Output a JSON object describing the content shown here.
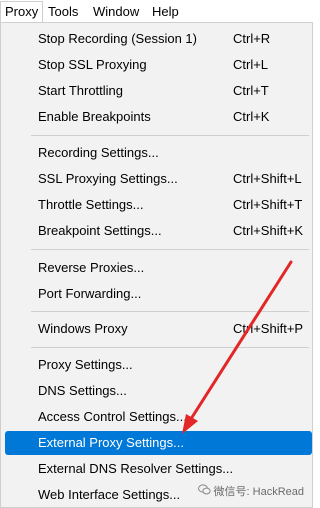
{
  "menubar": {
    "items": [
      {
        "label": "Proxy"
      },
      {
        "label": "Tools"
      },
      {
        "label": "Window"
      },
      {
        "label": "Help"
      }
    ]
  },
  "menu": {
    "items": [
      {
        "label": "Stop Recording (Session 1)",
        "shortcut": "Ctrl+R"
      },
      {
        "label": "Stop SSL Proxying",
        "shortcut": "Ctrl+L"
      },
      {
        "label": "Start Throttling",
        "shortcut": "Ctrl+T"
      },
      {
        "label": "Enable Breakpoints",
        "shortcut": "Ctrl+K"
      },
      {
        "label": "Recording Settings...",
        "shortcut": ""
      },
      {
        "label": "SSL Proxying Settings...",
        "shortcut": "Ctrl+Shift+L"
      },
      {
        "label": "Throttle Settings...",
        "shortcut": "Ctrl+Shift+T"
      },
      {
        "label": "Breakpoint Settings...",
        "shortcut": "Ctrl+Shift+K"
      },
      {
        "label": "Reverse Proxies...",
        "shortcut": ""
      },
      {
        "label": "Port Forwarding...",
        "shortcut": ""
      },
      {
        "label": "Windows Proxy",
        "shortcut": "Ctrl+Shift+P"
      },
      {
        "label": "Proxy Settings...",
        "shortcut": ""
      },
      {
        "label": "DNS Settings...",
        "shortcut": ""
      },
      {
        "label": "Access Control Settings...",
        "shortcut": ""
      },
      {
        "label": "External Proxy Settings...",
        "shortcut": ""
      },
      {
        "label": "External DNS Resolver Settings...",
        "shortcut": ""
      },
      {
        "label": "Web Interface Settings...",
        "shortcut": ""
      }
    ],
    "selected_label": "External Proxy Settings..."
  },
  "watermark": {
    "text": "微信号: HackRead",
    "icon": "wechat-icon"
  },
  "colors": {
    "selection": "#0078d7",
    "annotation_arrow": "#e32626",
    "menu_background": "#f2f2f2"
  }
}
